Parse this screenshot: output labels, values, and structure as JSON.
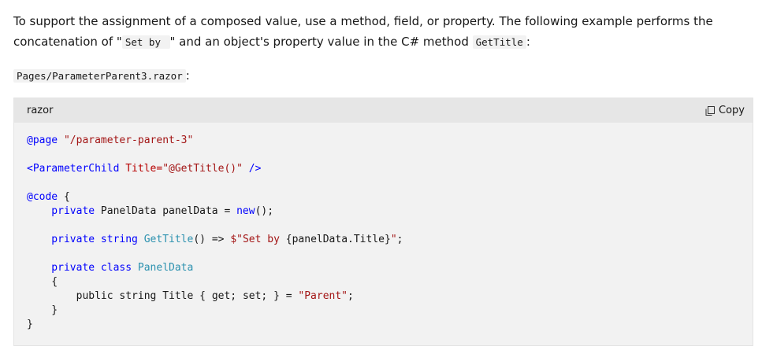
{
  "intro": {
    "text_before": "To support the assignment of a composed value, use a method, field, or property. The following example performs the concatenation of \"",
    "code_set_by": "Set by ",
    "text_middle": "\" and an object's property value in the C# method ",
    "code_method": "GetTitle",
    "text_after": ":"
  },
  "file": {
    "path": "Pages/ParameterParent3.razor",
    "suffix": ":"
  },
  "code_block": {
    "language": "razor",
    "copy_label": "Copy",
    "lines": [
      [
        {
          "t": "@page ",
          "c": "dir"
        },
        {
          "t": "\"/parameter-parent-3\"",
          "c": "str"
        }
      ],
      [],
      [
        {
          "t": "<ParameterChild ",
          "c": "tag"
        },
        {
          "t": "Title=",
          "c": "attr"
        },
        {
          "t": "\"@GetTitle()\"",
          "c": "str"
        },
        {
          "t": " />",
          "c": "tag"
        }
      ],
      [],
      [
        {
          "t": "@code ",
          "c": "dir"
        },
        {
          "t": "{",
          "c": ""
        }
      ],
      [
        {
          "t": "    private ",
          "c": "kw"
        },
        {
          "t": "PanelData panelData = ",
          "c": ""
        },
        {
          "t": "new",
          "c": "kw"
        },
        {
          "t": "();",
          "c": ""
        }
      ],
      [],
      [
        {
          "t": "    private ",
          "c": "kw"
        },
        {
          "t": "string ",
          "c": "kw"
        },
        {
          "t": "GetTitle",
          "c": "typ"
        },
        {
          "t": "() => ",
          "c": ""
        },
        {
          "t": "$\"Set by ",
          "c": "str"
        },
        {
          "t": "{panelData.Title}",
          "c": ""
        },
        {
          "t": "\"",
          "c": "str"
        },
        {
          "t": ";",
          "c": ""
        }
      ],
      [],
      [
        {
          "t": "    private ",
          "c": "kw"
        },
        {
          "t": "class ",
          "c": "kw"
        },
        {
          "t": "PanelData",
          "c": "typ"
        }
      ],
      [
        {
          "t": "    {",
          "c": ""
        }
      ],
      [
        {
          "t": "        public ",
          "c": ""
        },
        {
          "t": "string ",
          "c": ""
        },
        {
          "t": "Title { get; set; } = ",
          "c": ""
        },
        {
          "t": "\"Parent\"",
          "c": "str"
        },
        {
          "t": ";",
          "c": ""
        }
      ],
      [
        {
          "t": "    }",
          "c": ""
        }
      ],
      [
        {
          "t": "}",
          "c": ""
        }
      ]
    ]
  }
}
